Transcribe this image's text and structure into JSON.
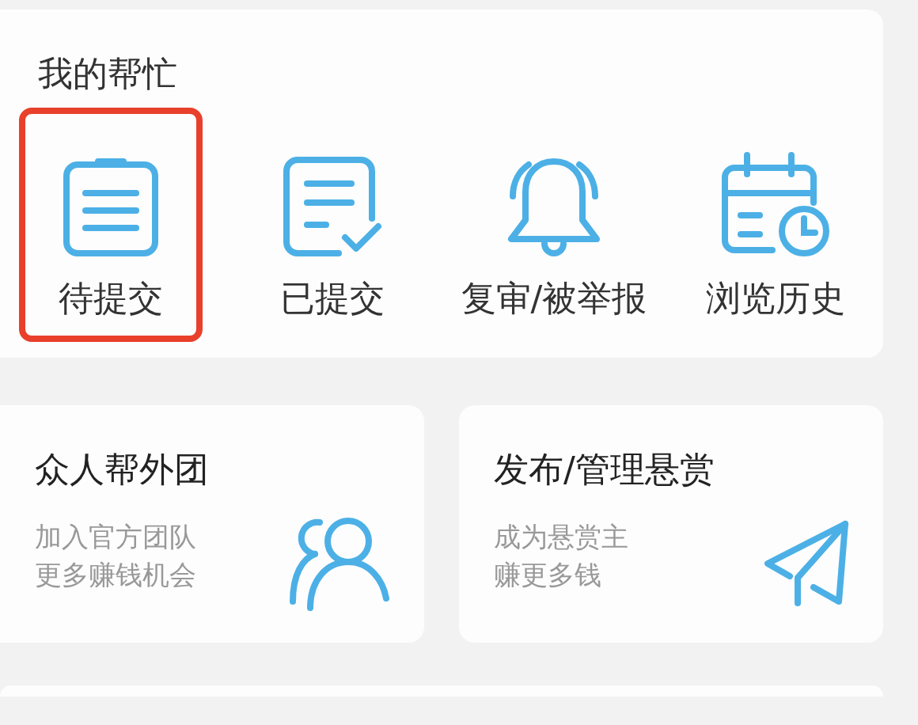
{
  "help": {
    "title": "我的帮忙",
    "items": [
      {
        "kind": "clipboard",
        "label": "待提交",
        "selected": true
      },
      {
        "kind": "checked-doc",
        "label": "已提交",
        "selected": false
      },
      {
        "kind": "bell",
        "label": "复审/被举报",
        "selected": false
      },
      {
        "kind": "calendar",
        "label": "浏览历史",
        "selected": false
      }
    ]
  },
  "cards": [
    {
      "kind": "people",
      "title": "众人帮外团",
      "lines": [
        "加入官方团队",
        "更多赚钱机会"
      ]
    },
    {
      "kind": "plane",
      "title": "发布/管理悬赏",
      "lines": [
        "成为悬赏主",
        "赚更多钱"
      ]
    }
  ]
}
